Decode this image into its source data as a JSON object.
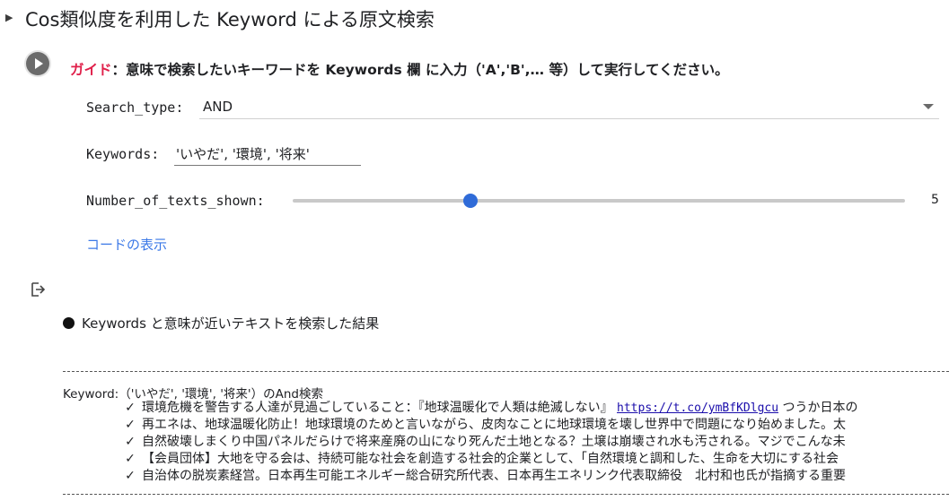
{
  "section": {
    "toggle_icon": "triangle-right-icon",
    "title": "Cos類似度を利用した Keyword による原文検索"
  },
  "cell": {
    "run_icon": "play-icon",
    "guide_label": "ガイド",
    "guide_text": "：意味で検索したいキーワードを Keywords 欄 に入力（'A','B',… 等）して実行してください。"
  },
  "form": {
    "search_type_label": "Search_type:",
    "search_type_value": "AND",
    "keywords_label": "Keywords:",
    "keywords_value": "'いやだ', '環境', '将来'",
    "texts_shown_label": "Number_of_texts_shown:",
    "texts_shown_value": "5",
    "texts_shown_fraction": 0.29,
    "show_code_link": "コードの表示"
  },
  "output": {
    "output_icon": "output-arrow-icon",
    "heading_bullet": "●",
    "heading": "Keywords と意味が近いテキストを検索した結果",
    "keyword_line": "Keyword:（'いやだ', '環境', '将来'）のAnd検索",
    "check_mark": "✓",
    "results": [
      {
        "before_link": "環境危機を警告する人達が見過ごしていること：『地球温暖化で人類は絶滅しない』 ",
        "link": "https://t.co/ymBfKDlgcu",
        "after_link": " つうか日本の"
      },
      {
        "text": "再エネは、地球温暖化防止！地球環境のためと言いながら、皮肉なことに地球環境を壊し世界中で問題になり始めました。太"
      },
      {
        "text": "自然破壊しまくり中国パネルだらけで将来産廃の山になり死んだ土地となる？土壌は崩壊され水も汚される。マジでこんな未"
      },
      {
        "text": "【会員団体】大地を守る会は、持続可能な社会を創造する社会的企業として、「自然環境と調和した、生命を大切にする社会"
      },
      {
        "text": "自治体の脱炭素経営。日本再生可能エネルギー総合研究所代表、日本再生エネリンク代表取締役　北村和也氏が指摘する重要"
      }
    ]
  },
  "colors": {
    "guide_label": "#e0204a",
    "slider_thumb": "#2f6bd8",
    "link": "#3b78e7"
  }
}
